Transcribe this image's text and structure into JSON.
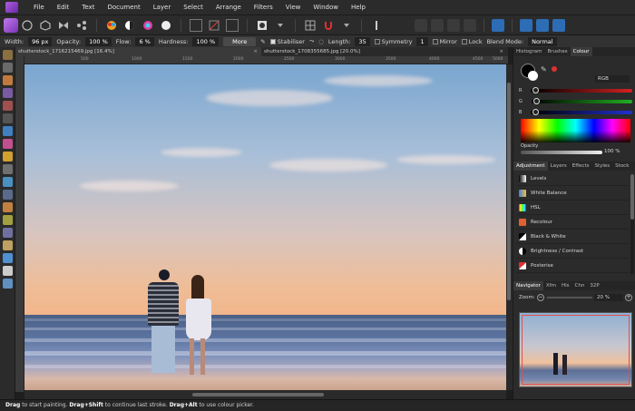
{
  "menu": [
    "File",
    "Edit",
    "Text",
    "Document",
    "Layer",
    "Select",
    "Arrange",
    "Filters",
    "View",
    "Window",
    "Help"
  ],
  "context": {
    "width_label": "Width:",
    "width_value": "96 px",
    "opacity_label": "Opacity:",
    "opacity_value": "100 %",
    "flow_label": "Flow:",
    "flow_value": "6 %",
    "hardness_label": "Hardness:",
    "hardness_value": "100 %",
    "more_label": "More",
    "stabiliser_label": "Stabiliser",
    "length_label": "Length:",
    "length_value": "35",
    "symmetry_label": "Symmetry",
    "symmetry_value": "1",
    "mirror_label": "Mirror",
    "lock_label": "Lock",
    "blend_label": "Blend Mode:",
    "blend_value": "Normal"
  },
  "tabs": [
    {
      "label": "shutterstock_1716215469.jpg [16.4%]",
      "close": "×"
    },
    {
      "label": "shutterstock_1708355685.jpg [20.0%]",
      "close": "×"
    }
  ],
  "ruler_ticks": [
    "500",
    "1000",
    "1500",
    "2000",
    "2500",
    "3000",
    "3500",
    "4000",
    "4500",
    "5000"
  ],
  "colour_panel": {
    "tabs": [
      "Histogram",
      "Brushes",
      "Colour"
    ],
    "model": "RGB",
    "channels": [
      "R",
      "G",
      "B"
    ],
    "opacity_label": "Opacity",
    "opacity_value": "100 %",
    "colors": {
      "red": "#d42020",
      "green": "#20b020",
      "blue": "#2030d0"
    }
  },
  "adjust_panel": {
    "tabs": [
      "Adjustment",
      "Layers",
      "Effects",
      "Styles",
      "Stock"
    ],
    "items": [
      "Levels",
      "White Balance",
      "HSL",
      "Recolour",
      "Black & White",
      "Brightness / Contrast",
      "Posterise"
    ]
  },
  "navigator": {
    "tabs": [
      "Navigator",
      "Xfm",
      "His",
      "Chn",
      "32P"
    ],
    "zoom_label": "Zoom:",
    "zoom_value": "20 %"
  },
  "status": {
    "key1": "Drag",
    "text1": " to start painting. ",
    "key2": "Drag+Shift",
    "text2": " to continue last stroke. ",
    "key3": "Drag+Alt",
    "text3": " to use colour picker."
  }
}
